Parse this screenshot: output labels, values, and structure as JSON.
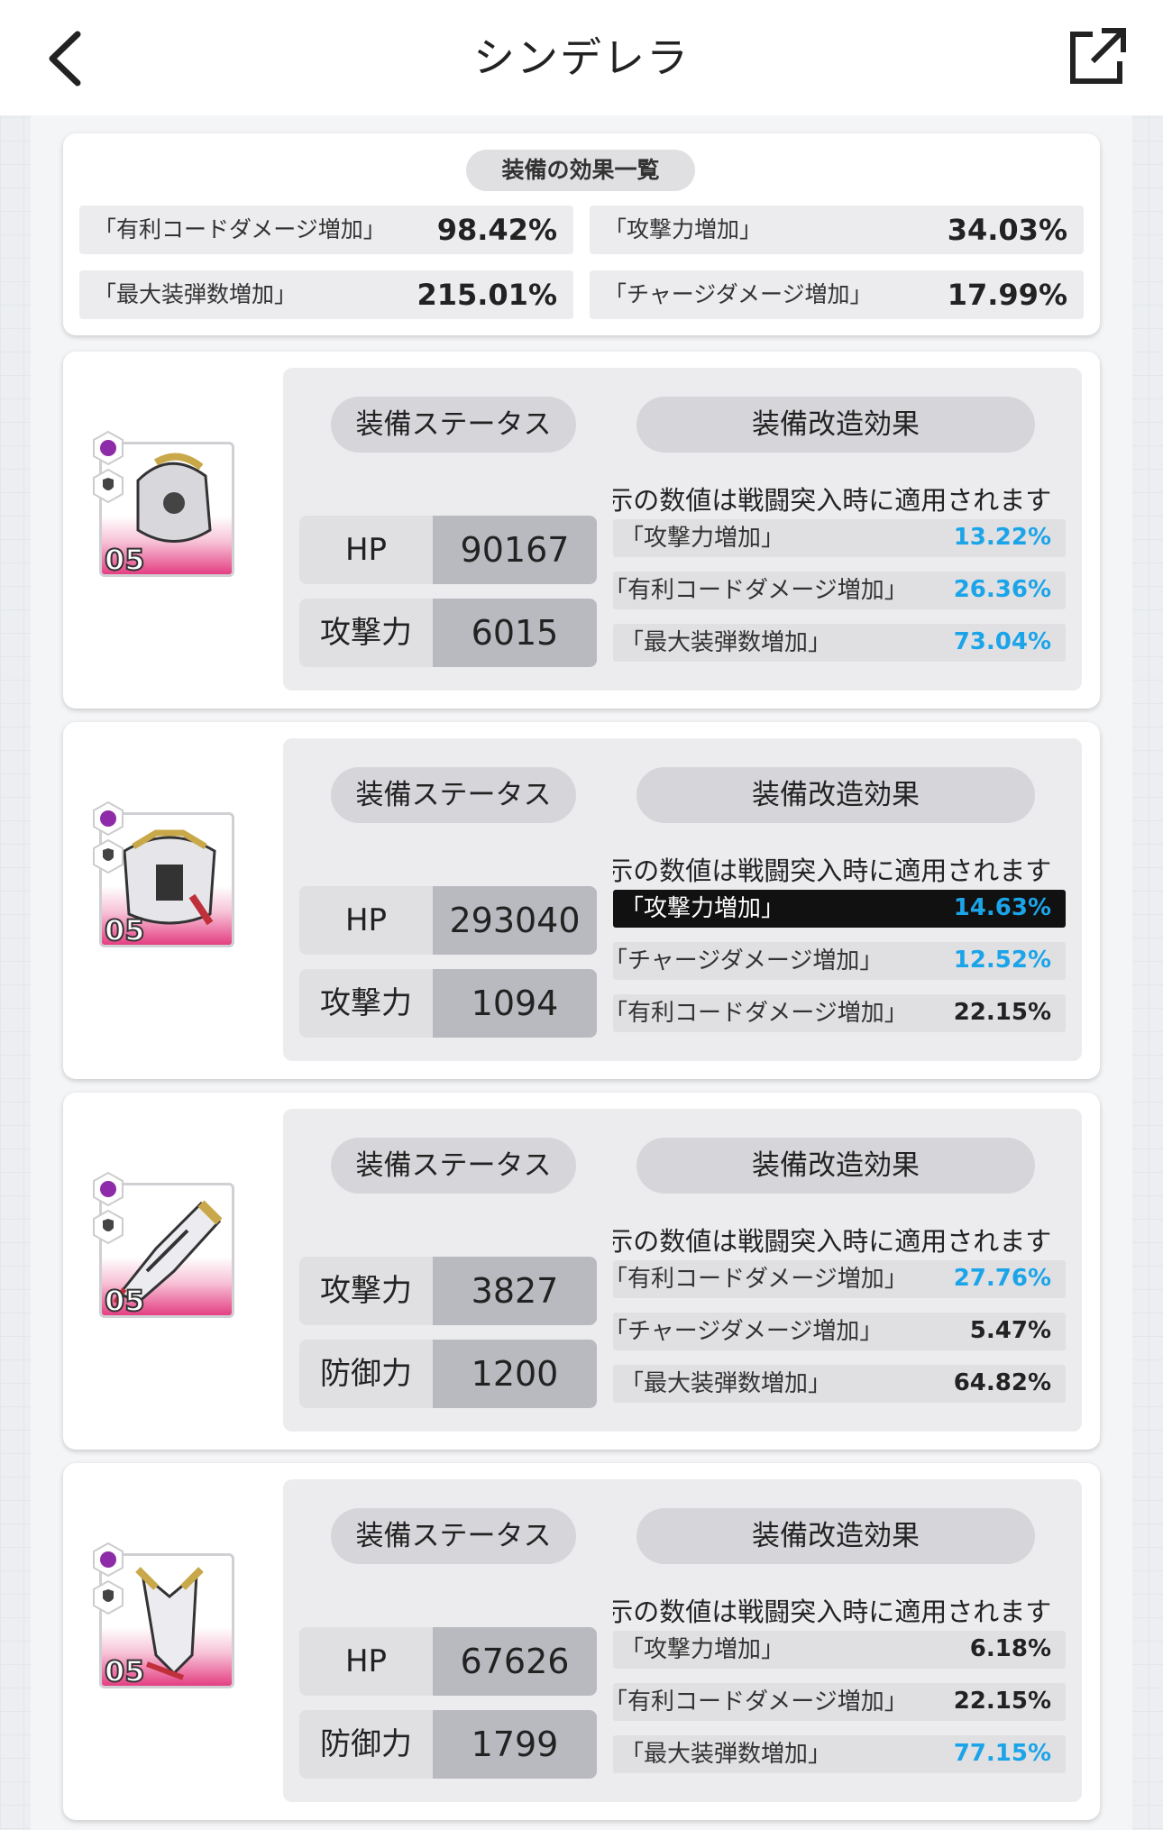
{
  "header": {
    "title": "シンデレラ"
  },
  "summary": {
    "title": "装備の効果一覧",
    "items": [
      {
        "label": "「有利コードダメージ増加」",
        "value": "98.42%"
      },
      {
        "label": "「攻撃力増加」",
        "value": "34.03%"
      },
      {
        "label": "「最大装弾数増加」",
        "value": "215.01%"
      },
      {
        "label": "「チャージダメージ増加」",
        "value": "17.99%"
      }
    ]
  },
  "equipment": [
    {
      "level": "05",
      "status_label": "装備ステータス",
      "mod_label": "装備改造効果",
      "note": "※表示の数値は戦闘突入時に適用されます",
      "stats": [
        {
          "key": "HP",
          "value": "90167"
        },
        {
          "key": "攻撃力",
          "value": "6015"
        }
      ],
      "effects": [
        {
          "label": "「攻撃力増加」",
          "value": "13.22%",
          "highlight": true
        },
        {
          "label": "「有利コードダメージ増加」",
          "value": "26.36%",
          "highlight": true
        },
        {
          "label": "「最大装弾数増加」",
          "value": "73.04%",
          "highlight": true
        }
      ]
    },
    {
      "level": "05",
      "status_label": "装備ステータス",
      "mod_label": "装備改造効果",
      "note": "※表示の数値は戦闘突入時に適用されます",
      "stats": [
        {
          "key": "HP",
          "value": "293040"
        },
        {
          "key": "攻撃力",
          "value": "1094"
        }
      ],
      "effects": [
        {
          "label": "「攻撃力増加」",
          "value": "14.63%",
          "highlight": true,
          "selected": true
        },
        {
          "label": "「チャージダメージ増加」",
          "value": "12.52%",
          "highlight": true
        },
        {
          "label": "「有利コードダメージ増加」",
          "value": "22.15%",
          "highlight": false
        }
      ]
    },
    {
      "level": "05",
      "status_label": "装備ステータス",
      "mod_label": "装備改造効果",
      "note": "※表示の数値は戦闘突入時に適用されます",
      "stats": [
        {
          "key": "攻撃力",
          "value": "3827"
        },
        {
          "key": "防御力",
          "value": "1200"
        }
      ],
      "effects": [
        {
          "label": "「有利コードダメージ増加」",
          "value": "27.76%",
          "highlight": true
        },
        {
          "label": "「チャージダメージ増加」",
          "value": "5.47%",
          "highlight": false
        },
        {
          "label": "「最大装弾数増加」",
          "value": "64.82%",
          "highlight": false
        }
      ]
    },
    {
      "level": "05",
      "status_label": "装備ステータス",
      "mod_label": "装備改造効果",
      "note": "※表示の数値は戦闘突入時に適用されます",
      "stats": [
        {
          "key": "HP",
          "value": "67626"
        },
        {
          "key": "防御力",
          "value": "1799"
        }
      ],
      "effects": [
        {
          "label": "「攻撃力増加」",
          "value": "6.18%",
          "highlight": false
        },
        {
          "label": "「有利コードダメージ増加」",
          "value": "22.15%",
          "highlight": false
        },
        {
          "label": "「最大装弾数増加」",
          "value": "77.15%",
          "highlight": true
        }
      ]
    }
  ],
  "colors": {
    "highlight": "#1ca4e8",
    "rarity": "#e43f83",
    "header_bg": "#ffffff"
  },
  "icons": [
    "back-chevron-icon",
    "share-external-icon",
    "rarity-hex-icon",
    "shield-hex-icon"
  ]
}
